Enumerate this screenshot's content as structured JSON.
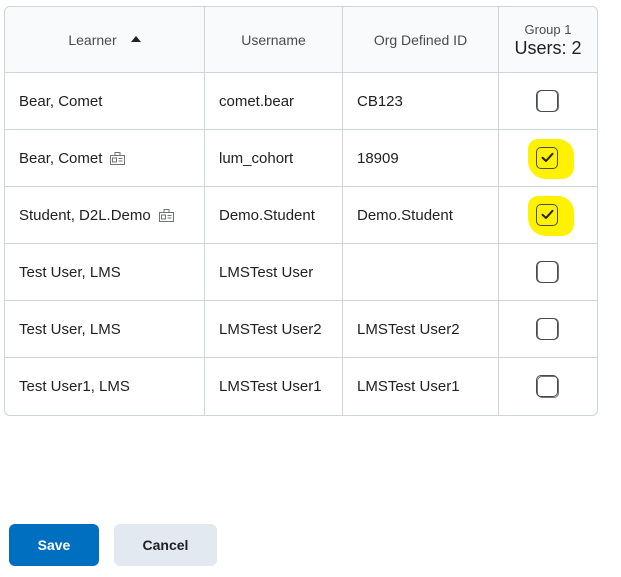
{
  "table": {
    "headers": {
      "learner": "Learner",
      "username": "Username",
      "org_id": "Org Defined ID",
      "group_title": "Group 1",
      "group_count": "Users: 2"
    },
    "rows": [
      {
        "learner": "Bear, Comet",
        "username": "comet.bear",
        "org_id": "CB123",
        "has_role_icon": false,
        "checked": false
      },
      {
        "learner": "Bear, Comet",
        "username": "lum_cohort",
        "org_id": "18909",
        "has_role_icon": true,
        "checked": true
      },
      {
        "learner": "Student, D2L.Demo",
        "username": "Demo.Student",
        "org_id": "Demo.Student",
        "has_role_icon": true,
        "checked": true
      },
      {
        "learner": "Test User, LMS",
        "username": "LMSTest User",
        "org_id": "",
        "has_role_icon": false,
        "checked": false
      },
      {
        "learner": "Test User, LMS",
        "username": "LMSTest User2",
        "org_id": "LMSTest User2",
        "has_role_icon": false,
        "checked": false
      },
      {
        "learner": "Test User1, LMS",
        "username": "LMSTest User1",
        "org_id": "LMSTest User1",
        "has_role_icon": false,
        "checked": false
      }
    ]
  },
  "buttons": {
    "save_label": "Save",
    "cancel_label": "Cancel"
  },
  "icons": {
    "sort": "sort-ascending-icon",
    "role": "role-switch-icon",
    "check": "checkmark-icon"
  },
  "colors": {
    "primary": "#006fbf",
    "secondary_button": "#e3e9f1",
    "highlight": "#fff200",
    "border": "#cdd5dc"
  }
}
